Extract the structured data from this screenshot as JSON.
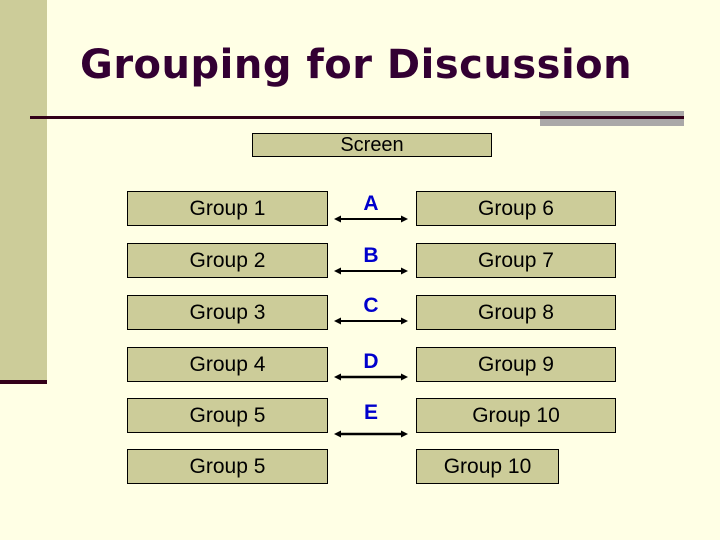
{
  "slide": {
    "title": "Grouping for Discussion",
    "screen_label": "Screen",
    "colors": {
      "background": "#ffffe5",
      "box_fill": "#cccc99",
      "title": "#330033",
      "letter": "#0000cc",
      "accent_bar": "#aaa8a8"
    }
  },
  "rows": [
    {
      "left": "Group 1",
      "letter": "A",
      "right": "Group 6"
    },
    {
      "left": "Group 2",
      "letter": "B",
      "right": "Group 7"
    },
    {
      "left": "Group 3",
      "letter": "C",
      "right": "Group 8"
    },
    {
      "left": "Group 4",
      "letter": "D",
      "right": "Group 9"
    },
    {
      "left": "Group 5",
      "letter": "E",
      "right": "Group 10"
    },
    {
      "left": "Group 5",
      "letter": "",
      "right": "Group 10"
    }
  ]
}
